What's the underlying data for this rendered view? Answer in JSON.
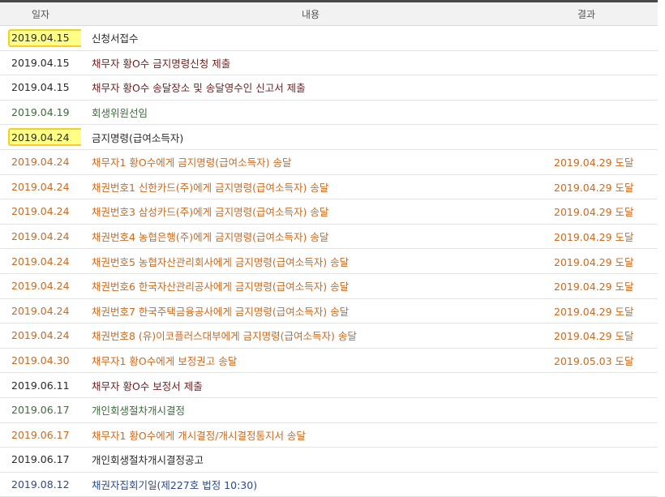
{
  "header": {
    "date": "일자",
    "content": "내용",
    "result": "결과"
  },
  "rows": [
    {
      "date": "2019.04.15",
      "content": "신청서접수",
      "result": "",
      "color": "black",
      "highlight": true
    },
    {
      "date": "2019.04.15",
      "content": "채무자 황O수 금지명령신청 제출",
      "result": "",
      "color": "maroon",
      "highlight": false
    },
    {
      "date": "2019.04.15",
      "content": "채무자 황O수 송달장소 및 송달영수인 신고서 제출",
      "result": "",
      "color": "maroon",
      "highlight": false
    },
    {
      "date": "2019.04.19",
      "content": "회생위원선임",
      "result": "",
      "color": "green",
      "highlight": false
    },
    {
      "date": "2019.04.24",
      "content": "금지명령(급여소득자)",
      "result": "",
      "color": "black",
      "highlight": true
    },
    {
      "date": "2019.04.24",
      "content": "채무자1 황O수에게 금지명령(급여소득자) 송달",
      "result": "2019.04.29 도달",
      "color": "orange",
      "highlight": false
    },
    {
      "date": "2019.04.24",
      "content": "채권번호1 신한카드(주)에게 금지명령(급여소득자) 송달",
      "result": "2019.04.29 도달",
      "color": "orange",
      "highlight": false
    },
    {
      "date": "2019.04.24",
      "content": "채권번호3 삼성카드(주)에게 금지명령(급여소득자) 송달",
      "result": "2019.04.29 도달",
      "color": "orange",
      "highlight": false
    },
    {
      "date": "2019.04.24",
      "content": "채권번호4 농협은행(주)에게 금지명령(급여소득자) 송달",
      "result": "2019.04.29 도달",
      "color": "orange",
      "highlight": false
    },
    {
      "date": "2019.04.24",
      "content": "채권번호5 농협자산관리회사에게 금지명령(급여소득자) 송달",
      "result": "2019.04.29 도달",
      "color": "orange",
      "highlight": false
    },
    {
      "date": "2019.04.24",
      "content": "채권번호6 한국자산관리공사에게 금지명령(급여소득자) 송달",
      "result": "2019.04.29 도달",
      "color": "orange",
      "highlight": false
    },
    {
      "date": "2019.04.24",
      "content": "채권번호7 한국주택금융공사에게 금지명령(급여소득자) 송달",
      "result": "2019.04.29 도달",
      "color": "orange",
      "highlight": false
    },
    {
      "date": "2019.04.24",
      "content": "채권번호8 (유)이코플러스대부에게 금지명령(급여소득자) 송달",
      "result": "2019.04.29 도달",
      "color": "orange",
      "highlight": false
    },
    {
      "date": "2019.04.30",
      "content": "채무자1 황O수에게 보정권고 송달",
      "result": "2019.05.03 도달",
      "color": "orange",
      "highlight": false
    },
    {
      "date": "2019.06.11",
      "content": "채무자 황O수 보정서 제출",
      "result": "",
      "color": "maroon",
      "highlight": false
    },
    {
      "date": "2019.06.17",
      "content": "개인회생절차개시결정",
      "result": "",
      "color": "green",
      "highlight": false
    },
    {
      "date": "2019.06.17",
      "content": "채무자1 황O수에게 개시결정/개시결정통지서 송달",
      "result": "",
      "color": "orange",
      "highlight": false
    },
    {
      "date": "2019.06.17",
      "content": "개인회생절차개시결정공고",
      "result": "",
      "color": "black",
      "highlight": false
    },
    {
      "date": "2019.08.12",
      "content": "채권자집회기일(제227호 법정 10:30)",
      "result": "",
      "color": "blue",
      "highlight": false
    }
  ]
}
